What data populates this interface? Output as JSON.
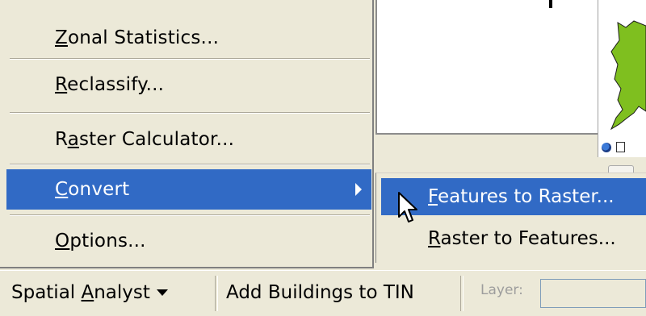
{
  "menu": {
    "items": [
      {
        "label": "Zonal Statistics...",
        "mnemonic": "Z",
        "rest": "onal Statistics..."
      },
      {
        "label": "Reclassify...",
        "mnemonic": "R",
        "rest": "eclassify..."
      },
      {
        "label": "Raster Calculator...",
        "pre": "R",
        "mnemonic": "a",
        "rest": "ster Calculator..."
      },
      {
        "label": "Convert",
        "mnemonic": "C",
        "rest": "onvert",
        "highlighted": true
      },
      {
        "label": "Options...",
        "mnemonic": "O",
        "rest": "ptions..."
      }
    ]
  },
  "submenu": {
    "items": [
      {
        "label": "Features to Raster...",
        "mnemonic": "F",
        "rest": "eatures to Raster...",
        "highlighted": true
      },
      {
        "label": "Raster to Features...",
        "mnemonic": "R",
        "rest": "aster to Features..."
      }
    ]
  },
  "toolbar": {
    "spatial_analyst": {
      "pre": "Spatial ",
      "mnemonic": "A",
      "rest": "nalyst"
    },
    "add_buildings_label": "Add Buildings to TIN",
    "layer_label": "Layer:"
  },
  "colors": {
    "highlight": "#316ac5",
    "menu_bg": "#ece9d8",
    "map_green": "#7fbf1f"
  }
}
